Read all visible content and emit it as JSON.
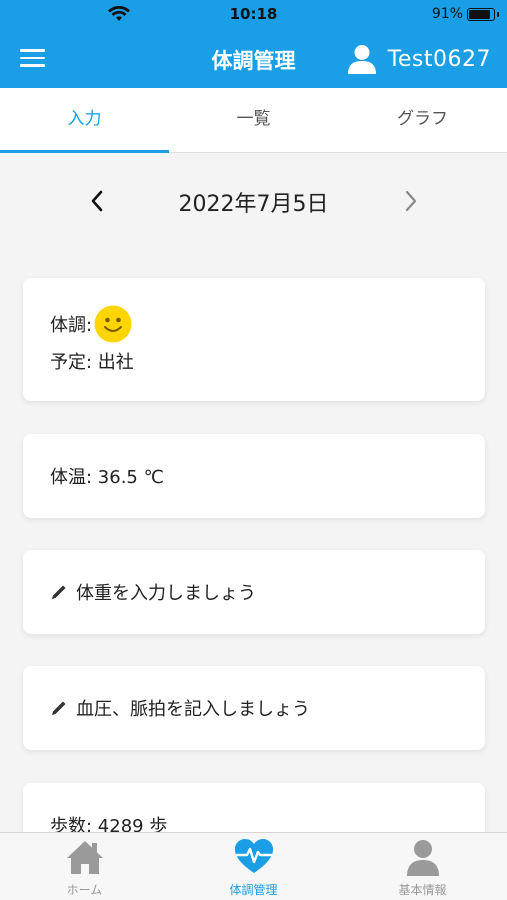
{
  "status_bar": {
    "time": "10:18",
    "battery": "91%"
  },
  "header": {
    "title": "体調管理",
    "user_name": "Test0627"
  },
  "tabs": [
    {
      "label": "入力",
      "active": true
    },
    {
      "label": "一覧",
      "active": false
    },
    {
      "label": "グラフ",
      "active": false
    }
  ],
  "date_nav": {
    "date": "2022年7月5日"
  },
  "cards": {
    "condition": {
      "label": "体調:",
      "schedule": "予定: 出社"
    },
    "temperature": {
      "text": "体温: 36.5 ℃"
    },
    "weight": {
      "text": "体重を入力しましょう"
    },
    "blood_pressure": {
      "text": "血圧、脈拍を記入しましょう"
    },
    "steps": {
      "text": "歩数: 4289 歩"
    }
  },
  "bottom_nav": [
    {
      "label": "ホーム",
      "icon": "home-icon",
      "active": false
    },
    {
      "label": "体調管理",
      "icon": "heartbeat-icon",
      "active": true
    },
    {
      "label": "基本情報",
      "icon": "person-icon",
      "active": false
    }
  ],
  "colors": {
    "accent": "#1a9ee6",
    "smiley": "#ffd500",
    "inactive_icon": "#9a9a9a"
  }
}
